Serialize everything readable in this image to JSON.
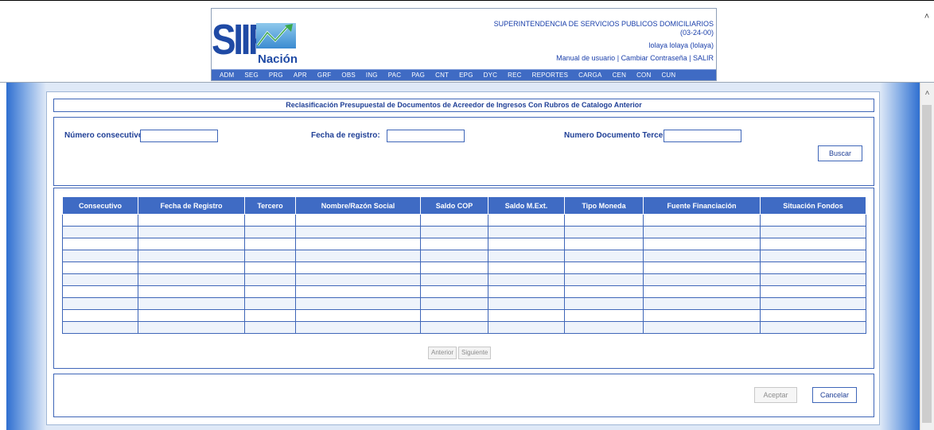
{
  "header": {
    "logo_text": "SIIF",
    "logo_sub": "Nación",
    "entity_name": "SUPERINTENDENCIA DE SERVICIOS PUBLICOS DOMICILIARIOS",
    "entity_code": "(03-24-00)",
    "user": "lolaya lolaya (lolaya)",
    "links": {
      "manual": "Manual de usuario",
      "sep1": "|",
      "password": "Cambiar Contraseña",
      "sep2": "|",
      "exit": "SALIR"
    },
    "nav": [
      "ADM",
      "SEG",
      "PRG",
      "APR",
      "GRF",
      "OBS",
      "ING",
      "PAC",
      "PAG",
      "CNT",
      "EPG",
      "DYC",
      "REC",
      "REPORTES",
      "CARGA",
      "CEN",
      "CON",
      "CUN"
    ]
  },
  "form": {
    "title": "Reclasificación Presupuestal de Documentos de Acreedor de Ingresos Con Rubros de Catalogo Anterior",
    "fields": {
      "consecutivo_label": "Número consecutivo:",
      "consecutivo_value": "",
      "fecha_label": "Fecha de registro:",
      "fecha_value": "",
      "documento_label": "Numero Documento Tercero:",
      "documento_value": ""
    },
    "search_button": "Buscar"
  },
  "table": {
    "columns": [
      "Consecutivo",
      "Fecha de Registro",
      "Tercero",
      "Nombre/Razón Social",
      "Saldo COP",
      "Saldo M.Ext.",
      "Tipo Moneda",
      "Fuente Financiación",
      "Situación Fondos"
    ],
    "rows": [
      [
        "",
        "",
        "",
        "",
        "",
        "",
        "",
        "",
        ""
      ],
      [
        "",
        "",
        "",
        "",
        "",
        "",
        "",
        "",
        ""
      ],
      [
        "",
        "",
        "",
        "",
        "",
        "",
        "",
        "",
        ""
      ],
      [
        "",
        "",
        "",
        "",
        "",
        "",
        "",
        "",
        ""
      ],
      [
        "",
        "",
        "",
        "",
        "",
        "",
        "",
        "",
        ""
      ],
      [
        "",
        "",
        "",
        "",
        "",
        "",
        "",
        "",
        ""
      ],
      [
        "",
        "",
        "",
        "",
        "",
        "",
        "",
        "",
        ""
      ],
      [
        "",
        "",
        "",
        "",
        "",
        "",
        "",
        "",
        ""
      ],
      [
        "",
        "",
        "",
        "",
        "",
        "",
        "",
        "",
        ""
      ],
      [
        "",
        "",
        "",
        "",
        "",
        "",
        "",
        "",
        ""
      ]
    ]
  },
  "pager": {
    "previous": "Anterior",
    "next": "Siguiente"
  },
  "actions": {
    "accept": "Aceptar",
    "cancel": "Cancelar"
  },
  "colors": {
    "primary": "#3f6bc4",
    "text": "#1f3f96",
    "accent_blue": "#2f6fd0"
  }
}
